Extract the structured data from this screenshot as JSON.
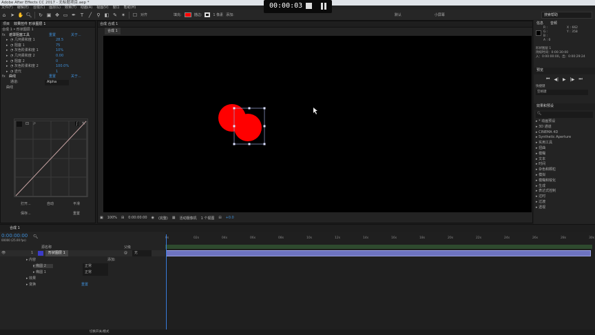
{
  "window": {
    "title": "Adobe After Effects CC 2017 - 无标题项目.aep *"
  },
  "recorder": {
    "time": "00:00:03"
  },
  "menu": [
    "文件(F)",
    "编辑(E)",
    "合成(C)",
    "图层(L)",
    "效果(T)",
    "动画(A)",
    "视图(V)",
    "窗口",
    "帮助(H)"
  ],
  "toolbar": {
    "snap_label": "对齐",
    "fill_label": "填充:",
    "stroke_label": "描边:",
    "stroke_width": "1 像素",
    "add_label": "添加:",
    "workspace": "默认",
    "workspace2": "小屏幕",
    "search_placeholder": "搜索帮助",
    "fill_color": "#ff0000"
  },
  "project_tab": "项目",
  "effects_panel": {
    "tab": "效果控件 形状图层 1",
    "breadcrumb": "合成 1 • 形状图层 1",
    "effect1": {
      "name": "遮罩阻塞工具",
      "reset": "重置",
      "about": "关于..."
    },
    "props": [
      {
        "name": "几何柔和度 1",
        "value": "28.5"
      },
      {
        "name": "阻塞 1",
        "value": "75"
      },
      {
        "name": "灰色阶柔和度 1",
        "value": "10%"
      },
      {
        "name": "几何柔和度 2",
        "value": "0.00"
      },
      {
        "name": "阻塞 2",
        "value": "0"
      },
      {
        "name": "灰色阶柔和度 2",
        "value": "100.0%"
      },
      {
        "name": "迭代",
        "value": "1"
      }
    ],
    "effect2": {
      "name": "曲线",
      "reset": "重置",
      "about": "关于..."
    },
    "channel_label": "通道:",
    "channel_value": "Alpha",
    "curve_label": "曲线",
    "curve_buttons": {
      "open": "打开...",
      "auto": "自动",
      "smooth": "平滑",
      "save": "保存...",
      "reset": "重置"
    }
  },
  "comp_panel": {
    "tab": "合成 合成 1",
    "subtab": "合成 1",
    "zoom": "100%",
    "timecode": "0:00:00:00",
    "resolution": "(完整)",
    "camera": "活动摄像机",
    "views": "1 个视图",
    "exposure": "+0.0"
  },
  "info_panel": {
    "tab1": "信息",
    "tab2": "音频",
    "r": "R :",
    "g": "G :",
    "b": "B :",
    "a": "A : 0",
    "x": "X : 662",
    "y": "Y : 358",
    "layer_name": "形状图层 1",
    "duration": "持续时间：0:00:30:00",
    "in_out": "入：0:00:00:00，出：0:00:29:24"
  },
  "preview_panel": {
    "tab": "预览",
    "shortcut_label": "快捷键",
    "shortcut_value": "空格键"
  },
  "fx_presets": {
    "tab": "效果和预设",
    "items": [
      "* 动画预设",
      "3D 通道",
      "CINEMA 4D",
      "Synthetic Aperture",
      "实用工具",
      "扭曲",
      "模糊",
      "文本",
      "时间",
      "杂色和颗粒",
      "模拟",
      "模糊和锐化",
      "生成",
      "表达式控制",
      "过时",
      "过渡",
      "透视"
    ]
  },
  "timeline": {
    "tab": "合成 1",
    "timecode": "0:00:00:00",
    "fps": "00000 (25.00 fps)",
    "col_source": "源名称",
    "col_parent": "父级",
    "layer_num": "1",
    "layer_name": "形状图层 1",
    "parent_value": "无",
    "contents": "内容",
    "add": "添加:",
    "ellipse2": "椭圆 2",
    "ellipse1": "椭圆 1",
    "mode": "正常",
    "effects": "效果",
    "transform": "变换",
    "reset": "重置",
    "ruler": [
      "0s",
      "02s",
      "04s",
      "06s",
      "08s",
      "10s",
      "12s",
      "14s",
      "16s",
      "18s",
      "20s",
      "22s",
      "24s",
      "26s",
      "28s",
      "30s"
    ],
    "status": "切换开关/模式"
  }
}
